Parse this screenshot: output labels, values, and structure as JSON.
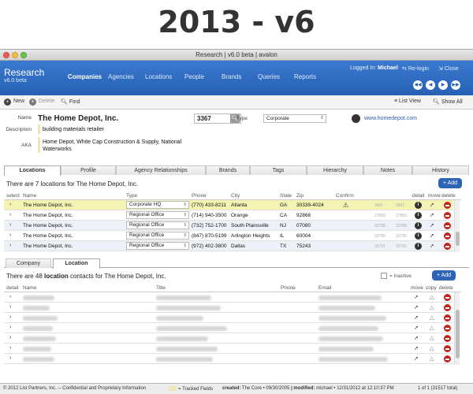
{
  "heading": "2013 - v6",
  "window": {
    "title": "Research | v6.0 beta | avalon"
  },
  "app": {
    "name": "Research",
    "version": "v6.0 beta",
    "nav": [
      "Companies",
      "Agencies",
      "Locations",
      "People",
      "Brands",
      "Queries",
      "Reports"
    ],
    "active_nav": "Companies",
    "logged_in_label": "Logged In:",
    "user": "Michael",
    "relogin": "Re-login",
    "close": "Close"
  },
  "toolbar": {
    "new": "New",
    "delete": "Delete",
    "find": "Find",
    "list_view": "List View",
    "show_all": "Show All"
  },
  "record": {
    "name_label": "Name",
    "name": "The Home Depot, Inc.",
    "id": "3367",
    "type_label": "Type",
    "type": "Corporate",
    "website": "www.homedepot.com",
    "description_label": "Description",
    "description": "building materials retailer",
    "aka_label": "AKA",
    "aka": "Home Depot, White Cap Construction & Supply, National Waterworks"
  },
  "tabs": [
    "Locations",
    "Profile",
    "Agency Relationships",
    "Brands",
    "Tags",
    "Hierarchy",
    "Notes",
    "History"
  ],
  "locations": {
    "summary": "There are 7 locations for The Home Depot, Inc.",
    "add_label": "Add",
    "columns": {
      "select": "select",
      "name": "Name",
      "type": "Type",
      "phone": "Phone",
      "city": "City",
      "state": "State",
      "zip": "Zip",
      "confirm": "Confirm",
      "detail": "detail",
      "move": "move",
      "delete": "delete"
    },
    "rows": [
      {
        "name": "The Home Depot, Inc.",
        "type": "Corporate HQ",
        "phone": "(770) 433-8211",
        "city": "Atlanta",
        "state": "GA",
        "zip": "30339-4024",
        "n1": "3461",
        "n2": "3461"
      },
      {
        "name": "The Home Depot, Inc.",
        "type": "Regional Office",
        "phone": "(714) 940-3500",
        "city": "Orange",
        "state": "CA",
        "zip": "92868",
        "n1": "27893",
        "n2": "27893"
      },
      {
        "name": "The Home Depot, Inc.",
        "type": "Regional Office",
        "phone": "(732) 752-1700",
        "city": "South Plainsville",
        "state": "NJ",
        "zip": "07080",
        "n1": "32788",
        "n2": "32788"
      },
      {
        "name": "The Home Depot, Inc.",
        "type": "Regional Office",
        "phone": "(847) 870-5199",
        "city": "Arlington Heights",
        "state": "IL",
        "zip": "60004",
        "n1": "32790",
        "n2": "32790"
      },
      {
        "name": "The Home Depot, Inc.",
        "type": "Regional Office",
        "phone": "(972) 402-3800",
        "city": "Dallas",
        "state": "TX",
        "zip": "75243",
        "n1": "32791",
        "n2": "32791"
      }
    ]
  },
  "subtabs": [
    "Company",
    "Location"
  ],
  "contacts": {
    "summary_pre": "There are 48",
    "summary_bold": "location",
    "summary_post": "contacts for The Home Depot, Inc.",
    "inactive_label": "= Inactive",
    "add_label": "Add",
    "columns": {
      "detail": "detail",
      "name": "Name",
      "title": "Title",
      "phone": "Phone",
      "email": "Email",
      "move": "move",
      "copy": "copy",
      "delete": "delete"
    }
  },
  "status": {
    "copyright": "© 2012 List Partners, Inc. -- Confidential and Proprietary Information",
    "tracked": "= Tracked Fields",
    "created_label": "created:",
    "created": "The Core  •  09/30/2005",
    "modified_label": "| modified:",
    "modified": "michael  •  12/31/2012 at 12:10:37 PM",
    "count": "1 of 1 (31517 total)"
  }
}
